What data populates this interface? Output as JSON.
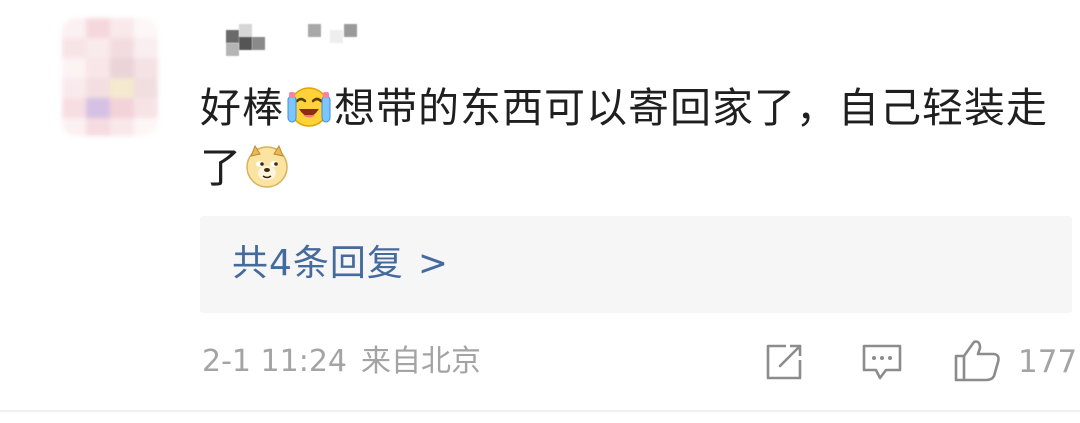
{
  "comment": {
    "text_part1": "好棒",
    "text_part2": "想带的东西可以寄回家了，自己轻装走了",
    "emoji_1": "laughing-crying-icon",
    "emoji_2": "doge-icon",
    "replies_label": "共4条回复",
    "replies_chevron": ">",
    "time": "2-1 11:24",
    "location": "来自北京",
    "like_count": "177"
  },
  "icons": {
    "share": "share-edit-icon",
    "comment": "comment-icon",
    "like": "thumbs-up-icon"
  },
  "colors": {
    "text": "#1f1f1f",
    "link": "#456a9c",
    "meta": "#a4a4a4",
    "reply_bg": "#f6f6f7"
  }
}
